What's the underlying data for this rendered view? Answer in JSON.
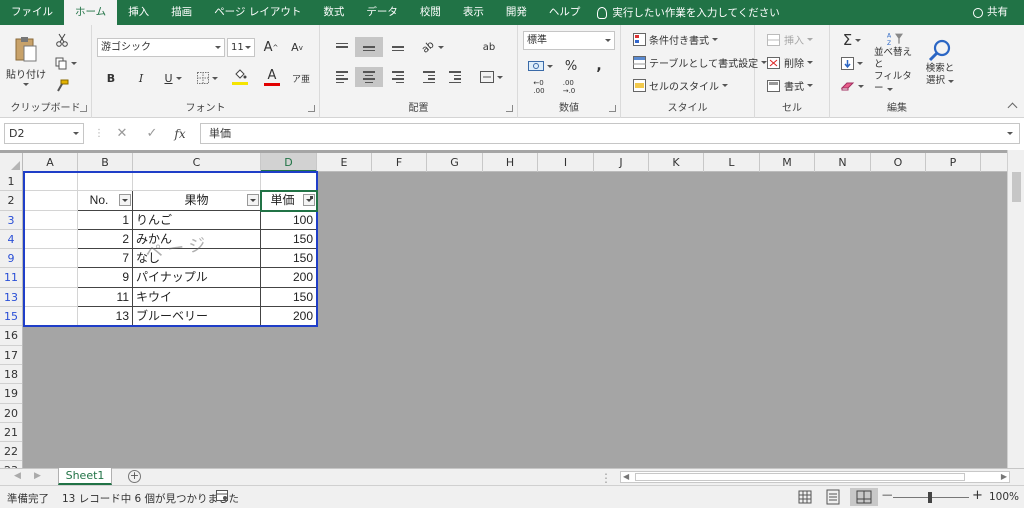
{
  "menu": {
    "tabs": [
      "ファイル",
      "ホーム",
      "挿入",
      "描画",
      "ページ レイアウト",
      "数式",
      "データ",
      "校閲",
      "表示",
      "開発",
      "ヘルプ"
    ],
    "active_index": 1,
    "tell_me": "実行したい作業を入力してください",
    "share": "共有"
  },
  "ribbon": {
    "clipboard": {
      "label": "クリップボード",
      "paste": "貼り付け"
    },
    "font": {
      "label": "フォント",
      "name": "游ゴシック",
      "size": "11",
      "grow": "A",
      "shrink": "A",
      "bold": "B",
      "italic": "I",
      "underline": "U",
      "font_color_letter": "A"
    },
    "alignment": {
      "label": "配置",
      "wrap": "ab"
    },
    "number": {
      "label": "数値",
      "format": "標準",
      "percent": "%",
      "comma": ","
    },
    "styles": {
      "label": "スタイル",
      "conditional": "条件付き書式",
      "as_table": "テーブルとして書式設定",
      "cell_styles": "セルのスタイル"
    },
    "cells": {
      "label": "セル",
      "insert": "挿入",
      "delete": "削除",
      "format": "書式"
    },
    "editing": {
      "label": "編集",
      "sigma": "Σ",
      "sort_filter_line1": "並べ替えと",
      "sort_filter_line2": "フィルター",
      "find_line1": "検索と",
      "find_line2": "選択"
    },
    "colors": {
      "font_underline": "#e10000",
      "fill_underline": "#f5e400"
    }
  },
  "formula_bar": {
    "name_box": "D2",
    "fx": "fx",
    "cancel": "✕",
    "enter": "✓",
    "content": "単価"
  },
  "sheet": {
    "columns": [
      "A",
      "B",
      "C",
      "D",
      "E",
      "F",
      "G",
      "H",
      "I",
      "J",
      "K",
      "L",
      "M",
      "N",
      "O",
      "P"
    ],
    "rows": [
      {
        "num": "1",
        "filtered": false,
        "cells": [
          "",
          "",
          "",
          ""
        ]
      },
      {
        "num": "2",
        "filtered": false,
        "cells": [
          "",
          "No.",
          "果物",
          "単価"
        ]
      },
      {
        "num": "3",
        "filtered": true,
        "cells": [
          "",
          "1",
          "りんご",
          "100"
        ]
      },
      {
        "num": "4",
        "filtered": true,
        "cells": [
          "",
          "2",
          "みかん",
          "150"
        ]
      },
      {
        "num": "9",
        "filtered": true,
        "cells": [
          "",
          "7",
          "なし",
          "150"
        ]
      },
      {
        "num": "11",
        "filtered": true,
        "cells": [
          "",
          "9",
          "パイナップル",
          "200"
        ]
      },
      {
        "num": "13",
        "filtered": true,
        "cells": [
          "",
          "11",
          "キウイ",
          "150"
        ]
      },
      {
        "num": "15",
        "filtered": true,
        "cells": [
          "",
          "13",
          "ブルーベリー",
          "200"
        ]
      },
      {
        "num": "16",
        "filtered": false
      },
      {
        "num": "17",
        "filtered": false
      },
      {
        "num": "18",
        "filtered": false
      },
      {
        "num": "19",
        "filtered": false
      },
      {
        "num": "20",
        "filtered": false
      },
      {
        "num": "21",
        "filtered": false
      },
      {
        "num": "22",
        "filtered": false
      },
      {
        "num": "23",
        "filtered": false
      }
    ],
    "watermark": "ページ",
    "tab": "Sheet1",
    "add_sheet": "+"
  },
  "status": {
    "ready": "準備完了",
    "filter_info": "13 レコード中 6 個が見つかりました",
    "zoom": "100%",
    "zoom_minus": "—",
    "zoom_plus": "+"
  }
}
